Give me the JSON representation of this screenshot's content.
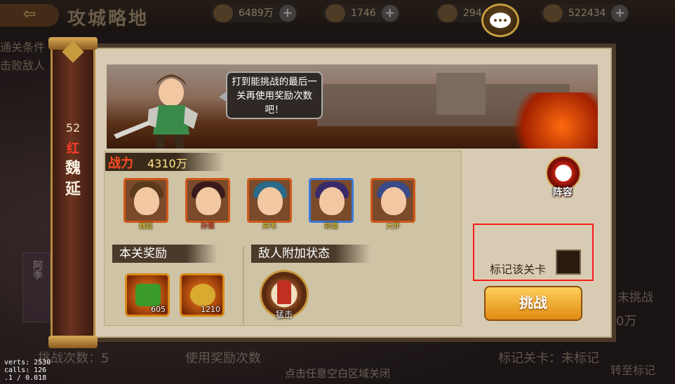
{
  "background": {
    "title": "攻城略地",
    "resources": [
      {
        "icon": "coin-icon",
        "value": "6489万"
      },
      {
        "icon": "gem-icon",
        "value": "1746"
      },
      {
        "icon": "token-icon",
        "value": "294"
      },
      {
        "icon": "ingot-icon",
        "value": "522434"
      }
    ],
    "left_lines": [
      "通关条件",
      "击败敌人"
    ],
    "bottom_left": "挑战次数：5",
    "bottom_mid": "使用奖励次数",
    "bottom_right": "标记关卡：未标记",
    "right_a": "未挑战",
    "right_b": "0万",
    "right_c": "转至标记",
    "side_tag": "阿季",
    "close_hint": "点击任意空白区域关闭"
  },
  "debug": {
    "lines": [
      "verts: 2530",
      "calls: 126",
      ".1 / 0.018"
    ]
  },
  "stage": {
    "level": "52",
    "rank": "红",
    "name_chars": [
      "魏",
      "延"
    ]
  },
  "dialog": {
    "speech": "打到能挑战的最后一关再使用奖励次数吧！",
    "power_label": "战力",
    "power_value": "4310万",
    "heroes": [
      {
        "name": "魏延",
        "frame": "orange",
        "hair": "#5a3a1a"
      },
      {
        "name": "孙策",
        "frame": "orange",
        "hair": "#3a1a1a"
      },
      {
        "name": "典韦",
        "frame": "orange",
        "hair": "#2a6a8a"
      },
      {
        "name": "郭嘉",
        "frame": "blue",
        "hair": "#3a2a6a"
      },
      {
        "name": "大乔",
        "frame": "orange",
        "hair": "#3a4a8a"
      }
    ],
    "reward_title": "本关奖励",
    "rewards": [
      {
        "icon": "jade-icon",
        "count": "605",
        "color": "#3a9a2a"
      },
      {
        "icon": "token-icon",
        "count": "1210",
        "color": "#d8aa30"
      }
    ],
    "buff_title": "敌人附加状态",
    "buffs": [
      {
        "name": "猛击"
      }
    ],
    "lineup_label": "阵容",
    "mark_label": "标记该关卡",
    "challenge_label": "挑战"
  }
}
